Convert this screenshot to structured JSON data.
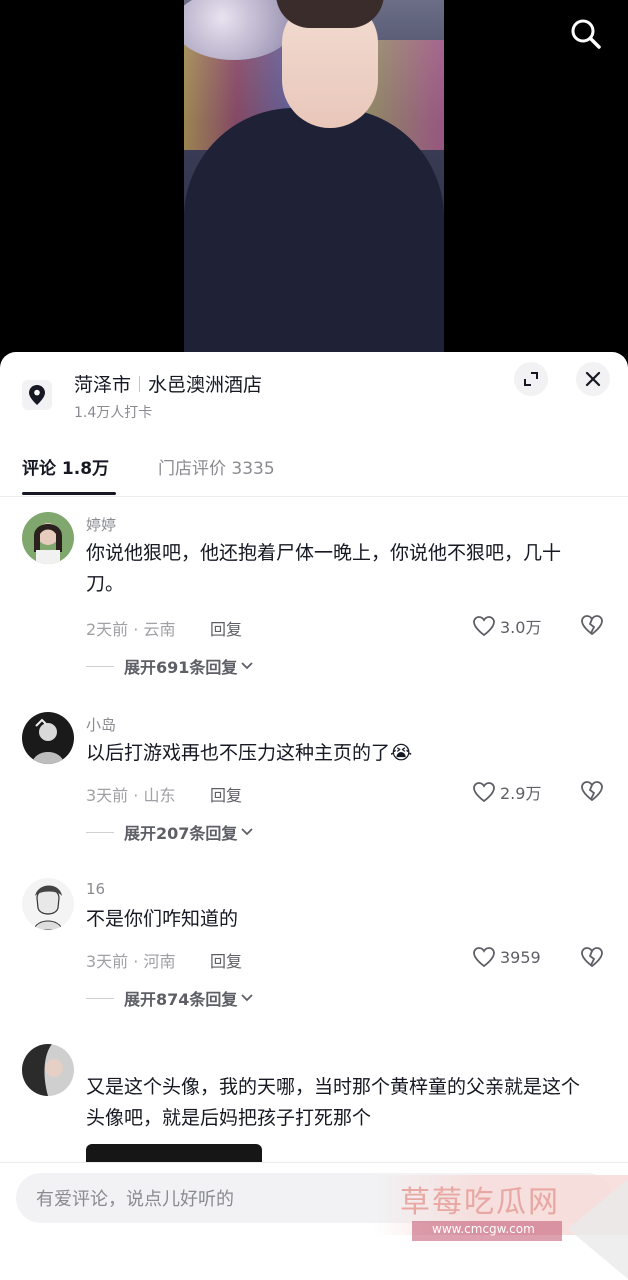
{
  "video": {
    "search_icon": "search-icon"
  },
  "poi": {
    "city": "菏泽市",
    "name": "水邑澳洲酒店",
    "checkins": "1.4万人打卡",
    "pin_icon": "location-pin-icon",
    "expand_icon": "expand-icon",
    "close_icon": "close-icon"
  },
  "tabs": [
    {
      "label": "评论 1.8万",
      "active": true
    },
    {
      "label": "门店评价 3335",
      "active": false
    }
  ],
  "comments": [
    {
      "nickname": "婷婷",
      "text": "你说他狠吧，他还抱着尸体一晚上，你说他不狠吧，几十刀。",
      "meta": "2天前 · 云南",
      "reply": "回复",
      "likes": "3.0万",
      "expand": "展开691条回复"
    },
    {
      "nickname": "小岛",
      "text": "以后打游戏再也不压力这种主页的了😭",
      "meta": "3天前 · 山东",
      "reply": "回复",
      "likes": "2.9万",
      "expand": "展开207条回复"
    },
    {
      "nickname": "16",
      "text": "不是你们咋知道的",
      "meta": "3天前 · 河南",
      "reply": "回复",
      "likes": "3959",
      "expand": "展开874条回复"
    },
    {
      "nickname": "",
      "text": "又是这个头像，我的天哪，当时那个黄梓童的父亲就是这个头像吧，就是后妈把孩子打死那个"
    }
  ],
  "input": {
    "placeholder": "有爱评论，说点儿好听的"
  },
  "watermark": {
    "title": "草莓吃瓜网",
    "url": "www.cmcgw.com"
  },
  "colors": {
    "text_primary": "#161823",
    "text_secondary": "#8a8b91",
    "background": "#ffffff",
    "video_bg": "#000000"
  }
}
